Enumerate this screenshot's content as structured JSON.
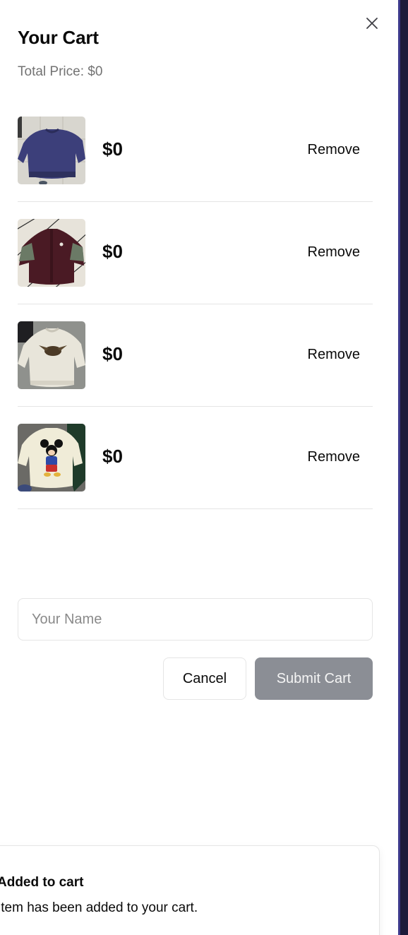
{
  "cart": {
    "title": "Your Cart",
    "total_label": "Total Price: $0",
    "close_icon": "close-icon"
  },
  "items": [
    {
      "image": "navy-sweatshirt-photo",
      "price": "$0",
      "remove_label": "Remove"
    },
    {
      "image": "maroon-jacket-photo",
      "price": "$0",
      "remove_label": "Remove"
    },
    {
      "image": "cream-sweatshirt-photo",
      "price": "$0",
      "remove_label": "Remove"
    },
    {
      "image": "mickey-sweatshirt-photo",
      "price": "$0",
      "remove_label": "Remove"
    }
  ],
  "form": {
    "name_placeholder": "Your Name",
    "name_value": "",
    "cancel_label": "Cancel",
    "submit_label": "Submit Cart"
  },
  "toast": {
    "title": "Added to cart",
    "description": "Item has been added to your cart."
  },
  "colors": {
    "submit_disabled_bg": "#8b8e95",
    "muted_text": "#737373",
    "border": "#e5e5e5",
    "edge": "#1c1b3a"
  }
}
